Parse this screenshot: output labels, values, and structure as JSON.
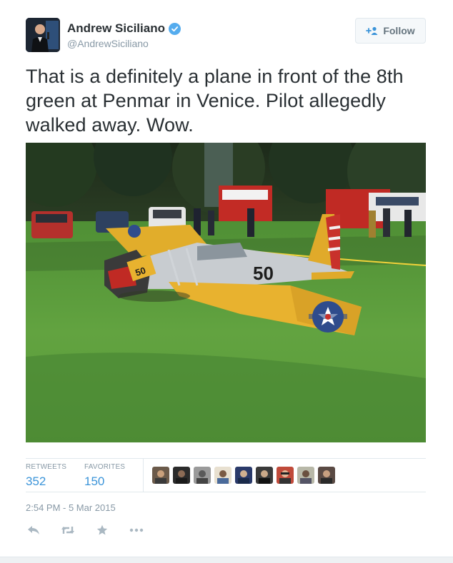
{
  "author": {
    "name": "Andrew Siciliano",
    "handle": "@AndrewSiciliano",
    "verified_icon": "verified-badge-icon",
    "avatar_icon": "avatar"
  },
  "follow_button": {
    "label": "Follow",
    "icon": "add-user-icon"
  },
  "tweet": {
    "text": "That is a definitely a plane in front of the 8th green at Penmar in Venice. Pilot allegedly walked away. Wow."
  },
  "photo": {
    "plane_number": "50",
    "subject": "crashed-yellow-plane-on-golf-course"
  },
  "stats": {
    "retweets_label": "RETWEETS",
    "retweets_value": "352",
    "favorites_label": "FAVORITES",
    "favorites_value": "150",
    "favorited_by_count": 9
  },
  "timestamp": "2:54 PM - 5 Mar 2015",
  "actions": [
    "reply-icon",
    "retweet-icon",
    "favorite-icon",
    "more-icon"
  ],
  "colors": {
    "link_blue": "#3b94d9",
    "verified_blue": "#55acee",
    "muted_gray": "#8899a6"
  }
}
